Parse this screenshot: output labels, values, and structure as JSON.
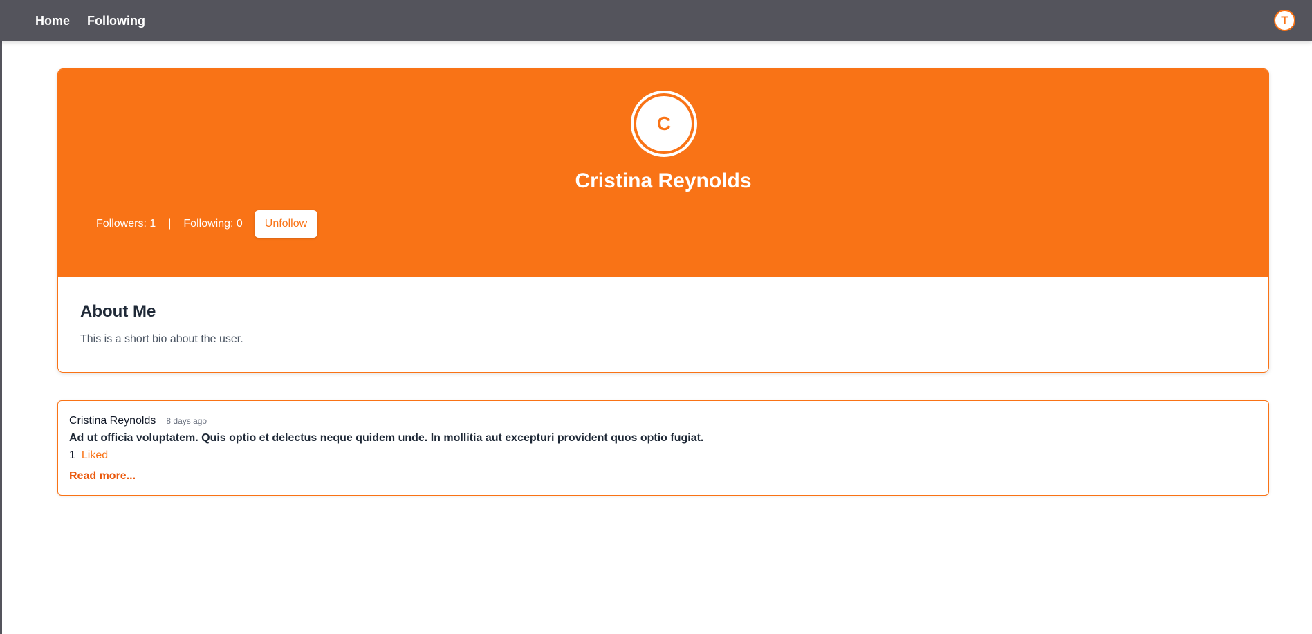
{
  "nav": {
    "home_label": "Home",
    "following_label": "Following",
    "avatar_initial": "T"
  },
  "profile": {
    "avatar_initial": "C",
    "name": "Cristina Reynolds",
    "followers_text": "Followers: 1",
    "separator": "|",
    "following_text": "Following: 0",
    "unfollow_label": "Unfollow"
  },
  "about": {
    "title": "About Me",
    "bio": "This is a short bio about the user."
  },
  "posts": [
    {
      "author": "Cristina Reynolds",
      "time": "8 days ago",
      "body": "Ad ut officia voluptatem. Quis optio et delectus neque quidem unde. In mollitia aut excepturi provident quos optio fugiat.",
      "like_count": "1",
      "liked_label": "Liked",
      "read_more_label": "Read more..."
    }
  ],
  "colors": {
    "navbar": "#54545c",
    "accent": "#f97316",
    "link": "#ea580c"
  }
}
